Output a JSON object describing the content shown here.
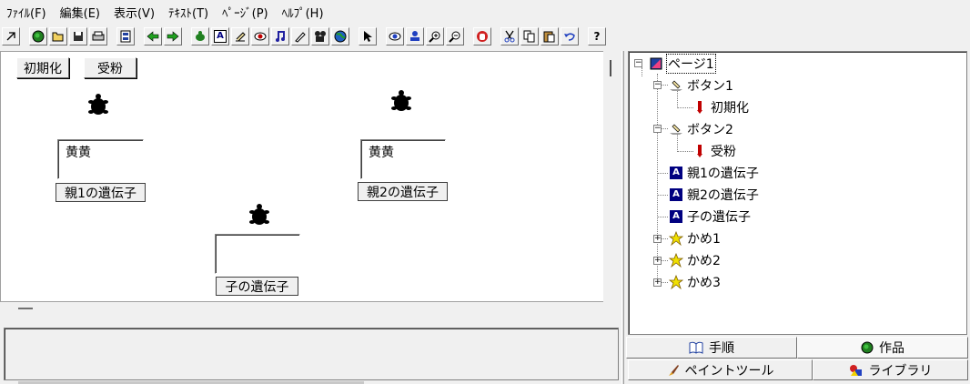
{
  "menubar": {
    "items": [
      {
        "label": "ﾌｧｲﾙ(F)"
      },
      {
        "label": "編集(E)"
      },
      {
        "label": "表示(V)"
      },
      {
        "label": "ﾃｷｽﾄ(T)"
      },
      {
        "label": "ﾍﾟｰｼﾞ(P)"
      },
      {
        "label": "ﾍﾙﾌﾟ(H)"
      }
    ]
  },
  "toolbar": {
    "icons": [
      "pointer-arrow-icon",
      "globe-icon",
      "open-folder-icon",
      "save-disk-icon",
      "print-icon",
      "layout-icon",
      "back-arrow-icon",
      "forward-arrow-icon",
      "turtle-icon",
      "text-a-icon",
      "button-hand-icon",
      "eye-oval-icon",
      "music-note-icon",
      "pen-icon",
      "film-camera-icon",
      "earth-icon",
      "select-cursor-icon",
      "view-eye-icon",
      "stamp-icon",
      "zoom-in-icon",
      "zoom-out-icon",
      "stop-hand-icon",
      "cut-icon",
      "copy-icon",
      "paste-icon",
      "undo-icon",
      "help-icon"
    ],
    "help_label": "?",
    "text_a_label": "A"
  },
  "canvas": {
    "buttons": {
      "init": "初期化",
      "pollinate": "受粉"
    },
    "parent1_value": "黄黄",
    "parent2_value": "黄黄",
    "child_value": "",
    "labels": {
      "parent1": "親1の遺伝子",
      "parent2": "親2の遺伝子",
      "child": "子の遺伝子"
    }
  },
  "tree": {
    "nodes": [
      {
        "label": "ページ1",
        "icon": "page-icon"
      },
      {
        "label": "ボタン1",
        "icon": "button-icon"
      },
      {
        "label": "初期化",
        "icon": "script-icon"
      },
      {
        "label": "ボタン2",
        "icon": "button-icon"
      },
      {
        "label": "受粉",
        "icon": "script-icon"
      },
      {
        "label": "親1の遺伝子",
        "icon": "text-box-icon"
      },
      {
        "label": "親2の遺伝子",
        "icon": "text-box-icon"
      },
      {
        "label": "子の遺伝子",
        "icon": "text-box-icon"
      },
      {
        "label": "かめ1",
        "icon": "turtle-star-icon"
      },
      {
        "label": "かめ2",
        "icon": "turtle-star-icon"
      },
      {
        "label": "かめ3",
        "icon": "turtle-star-icon"
      }
    ],
    "text_box_icon_letter": "A"
  },
  "tabs": {
    "procedure": "手順",
    "works": "作品",
    "paint_tool": "ペイントツール",
    "library": "ライブラリ"
  },
  "colors": {
    "panel_bg": "#f0f0f0",
    "canvas_bg": "#ffffff",
    "turtle": "#000000",
    "text_box_icon_bg": "#000080",
    "script_icon": "#c00000",
    "star_icon": "#f0e000"
  }
}
